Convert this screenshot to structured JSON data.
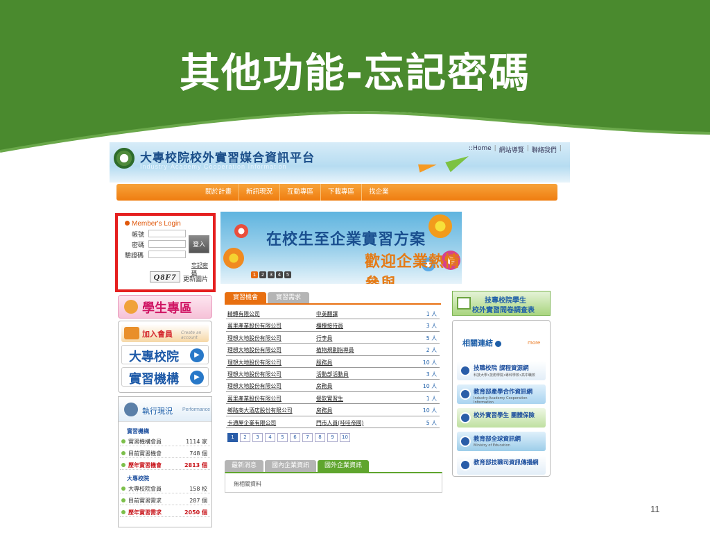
{
  "slide": {
    "title": "其他功能-忘記密碼",
    "page_number": "11",
    "colors": {
      "header_green": "#4a8a2e",
      "highlight_red": "#e51f1f"
    }
  },
  "site": {
    "name": "大專校院校外實習媒合資訊平台",
    "name_en": "Industry-Academy Cooperation Information",
    "top_links": [
      "::Home",
      "網站導覽",
      "聯絡我們"
    ],
    "nav": [
      "關於計畫",
      "新訊現況",
      "互動專區",
      "下載專區",
      "找企業"
    ],
    "login": {
      "title": "Member's Login",
      "account_label": "帳號",
      "password_label": "密碼",
      "captcha_label": "驗證碼",
      "login_button": "登入",
      "forgot_link": "忘記密碼",
      "captcha_text": "Q8F7",
      "refresh_link": "更新圖片"
    },
    "student_zone": "學生專區",
    "join_member": "加入會員",
    "join_member_sub": "Create an account",
    "college_button": "大專校院",
    "org_button": "實習機構",
    "exec": {
      "title": "執行現況",
      "title_en": "Performance",
      "section1": "實習機構",
      "rows1": [
        {
          "label": "實習機構會員",
          "value": "1114 家",
          "highlight": false
        },
        {
          "label": "目前實習機會",
          "value": "748 個",
          "highlight": false
        },
        {
          "label": "歷年實習機會",
          "value": "2813 個",
          "highlight": true
        }
      ],
      "section2": "大專校院",
      "rows2": [
        {
          "label": "大專校院會員",
          "value": "158 校",
          "highlight": false
        },
        {
          "label": "目前實習需求",
          "value": "287 個",
          "highlight": false
        },
        {
          "label": "歷年實習需求",
          "value": "2050 個",
          "highlight": true
        }
      ]
    },
    "banner": {
      "title": "在校生至企業實習方案",
      "subtitle": "歡迎企業熱情參與",
      "pages": [
        "1",
        "2",
        "3",
        "4",
        "5"
      ]
    },
    "job_tabs": [
      "實習機會",
      "實習需求"
    ],
    "jobs": [
      {
        "company": "精轉有限公司",
        "position": "中英翻譯",
        "count": "1 人"
      },
      {
        "company": "萬里產業股份有限公司",
        "position": "櫃檯接待員",
        "count": "3 人"
      },
      {
        "company": "理想大地股份有限公司",
        "position": "行李員",
        "count": "5 人"
      },
      {
        "company": "理想大地股份有限公司",
        "position": "植物規劃指導員",
        "count": "2 人"
      },
      {
        "company": "理想大地股份有限公司",
        "position": "服務員",
        "count": "10 人"
      },
      {
        "company": "理想大地股份有限公司",
        "position": "活動部活動員",
        "count": "3 人"
      },
      {
        "company": "理想大地股份有限公司",
        "position": "房務員",
        "count": "10 人"
      },
      {
        "company": "萬里產業股份有限公司",
        "position": "餐飲實習生",
        "count": "1 人"
      },
      {
        "company": "鄉路商大酒店股份有限公司",
        "position": "房務員",
        "count": "10 人"
      },
      {
        "company": "卡通屋企業有限公司",
        "position": "門市人員(哇哇帝國)",
        "count": "5 人"
      }
    ],
    "job_pages": [
      "1",
      "2",
      "3",
      "4",
      "5",
      "6",
      "7",
      "8",
      "9",
      "10"
    ],
    "news_tabs": [
      "最新消息",
      "國內企業資訊",
      "國外企業資訊"
    ],
    "news_empty": "無相關資料",
    "survey": {
      "line1": "技專校院學生",
      "line2": "校外實習問卷調查表"
    },
    "links": {
      "title": "相關連結",
      "more": "more",
      "cards": [
        {
          "text": "技職校院 課程資源網",
          "sub": "科技大學•技術學院•專科學校•高中職校"
        },
        {
          "text": "教育部產學合作資訊網",
          "sub": "Industry-Academy Cooperation Information"
        },
        {
          "text": "校外實習學生 團體保險",
          "sub": ""
        },
        {
          "text": "教育部全球資訊網",
          "sub": "Ministry of Education"
        },
        {
          "text": "教育部技職司資訊傳播網",
          "sub": ""
        }
      ]
    }
  }
}
